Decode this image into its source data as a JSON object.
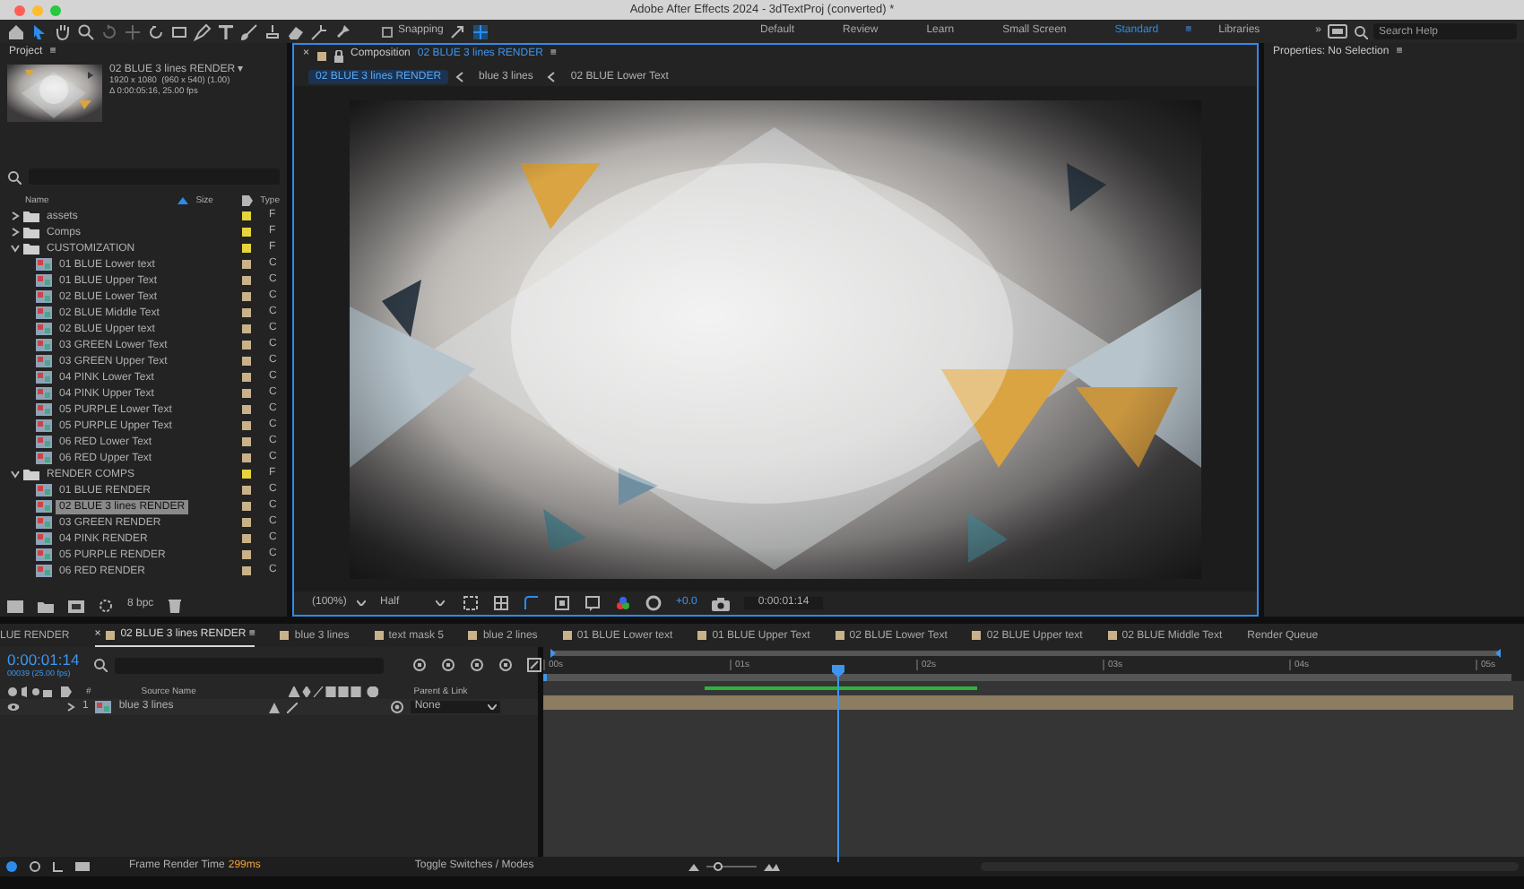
{
  "window": {
    "title": "Adobe After Effects 2024 - 3dTextProj (converted) *"
  },
  "toolbar": {
    "snapping": {
      "label": "Snapping",
      "checked": false
    },
    "workspaces": [
      {
        "label": "Default",
        "selected": false
      },
      {
        "label": "Review",
        "selected": false
      },
      {
        "label": "Learn",
        "selected": false
      },
      {
        "label": "Small Screen",
        "selected": false
      },
      {
        "label": "Standard",
        "selected": true,
        "menu": "≡"
      },
      {
        "label": "Libraries",
        "selected": false
      }
    ],
    "more": "»",
    "search": {
      "placeholder": "Search Help"
    }
  },
  "project": {
    "title": "Project",
    "menu": "≡",
    "selected_name": "02 BLUE 3 lines RENDER ▾",
    "info": [
      "1920 x 1080  (960 x 540) (1.00)",
      "Δ 0:00:05:16, 25.00 fps"
    ],
    "columns": [
      "Name",
      "Size",
      "Type"
    ],
    "items": [
      {
        "kind": "folder",
        "name": "assets",
        "type": "F",
        "color": "#e6d43c",
        "expanded": false,
        "selected": false
      },
      {
        "kind": "folder",
        "name": "Comps",
        "type": "F",
        "color": "#e6d43c",
        "expanded": false,
        "selected": false
      },
      {
        "kind": "folder",
        "name": "CUSTOMIZATION",
        "type": "F",
        "color": "#e6d43c",
        "expanded": true,
        "selected": false,
        "children": [
          {
            "kind": "comp",
            "name": "01 BLUE Lower text",
            "type": "C",
            "color": "#c9b28a",
            "selected": false
          },
          {
            "kind": "comp",
            "name": "01 BLUE Upper Text",
            "type": "C",
            "color": "#c9b28a",
            "selected": false
          },
          {
            "kind": "comp",
            "name": "02 BLUE Lower Text",
            "type": "C",
            "color": "#c9b28a",
            "selected": false
          },
          {
            "kind": "comp",
            "name": "02 BLUE Middle Text",
            "type": "C",
            "color": "#c9b28a",
            "selected": false
          },
          {
            "kind": "comp",
            "name": "02 BLUE Upper text",
            "type": "C",
            "color": "#c9b28a",
            "selected": false
          },
          {
            "kind": "comp",
            "name": "03 GREEN Lower Text",
            "type": "C",
            "color": "#c9b28a",
            "selected": false
          },
          {
            "kind": "comp",
            "name": "03 GREEN Upper Text",
            "type": "C",
            "color": "#c9b28a",
            "selected": false
          },
          {
            "kind": "comp",
            "name": "04 PINK Lower Text",
            "type": "C",
            "color": "#c9b28a",
            "selected": false
          },
          {
            "kind": "comp",
            "name": "04 PINK Upper Text",
            "type": "C",
            "color": "#c9b28a",
            "selected": false
          },
          {
            "kind": "comp",
            "name": "05 PURPLE Lower Text",
            "type": "C",
            "color": "#c9b28a",
            "selected": false
          },
          {
            "kind": "comp",
            "name": "05 PURPLE Upper Text",
            "type": "C",
            "color": "#c9b28a",
            "selected": false
          },
          {
            "kind": "comp",
            "name": "06 RED Lower Text",
            "type": "C",
            "color": "#c9b28a",
            "selected": false
          },
          {
            "kind": "comp",
            "name": "06 RED Upper Text",
            "type": "C",
            "color": "#c9b28a",
            "selected": false
          }
        ]
      },
      {
        "kind": "folder",
        "name": "RENDER COMPS",
        "type": "F",
        "color": "#e6d43c",
        "expanded": true,
        "selected": false,
        "children": [
          {
            "kind": "comp",
            "name": "01 BLUE RENDER",
            "type": "C",
            "color": "#c9b28a",
            "selected": false
          },
          {
            "kind": "comp",
            "name": "02 BLUE 3 lines RENDER",
            "type": "C",
            "color": "#c9b28a",
            "selected": true
          },
          {
            "kind": "comp",
            "name": "03 GREEN RENDER",
            "type": "C",
            "color": "#c9b28a",
            "selected": false
          },
          {
            "kind": "comp",
            "name": "04 PINK RENDER",
            "type": "C",
            "color": "#c9b28a",
            "selected": false
          },
          {
            "kind": "comp",
            "name": "05 PURPLE RENDER",
            "type": "C",
            "color": "#c9b28a",
            "selected": false
          },
          {
            "kind": "comp",
            "name": "06 RED RENDER",
            "type": "C",
            "color": "#c9b28a",
            "selected": false
          }
        ]
      }
    ],
    "bpc": "8 bpc"
  },
  "composition": {
    "close": "×",
    "title": "Composition",
    "name": "02 BLUE 3 lines RENDER",
    "menu": "≡",
    "breadcrumbs": [
      {
        "label": "02 BLUE 3 lines RENDER",
        "selected": true
      },
      {
        "label": "blue 3 lines",
        "selected": false
      },
      {
        "label": "02 BLUE Lower Text",
        "selected": false
      }
    ],
    "zoom": "(100%)",
    "resolution": "Half",
    "exposure": "+0.0",
    "time": "0:00:01:14"
  },
  "properties": {
    "title": "Properties: No Selection",
    "menu": "≡"
  },
  "timeline": {
    "tabs": [
      {
        "label": "LUE RENDER",
        "swatch": false,
        "selected": false
      },
      {
        "label": "02 BLUE 3 lines RENDER",
        "swatch": true,
        "selected": true,
        "close": "×",
        "menu": "≡"
      },
      {
        "label": "blue 3 lines",
        "swatch": true,
        "selected": false
      },
      {
        "label": "text mask 5",
        "swatch": true,
        "selected": false
      },
      {
        "label": "blue 2 lines",
        "swatch": true,
        "selected": false
      },
      {
        "label": "01 BLUE Lower text",
        "swatch": true,
        "selected": false
      },
      {
        "label": "01 BLUE Upper Text",
        "swatch": true,
        "selected": false
      },
      {
        "label": "02 BLUE Lower Text",
        "swatch": true,
        "selected": false
      },
      {
        "label": "02 BLUE Upper text",
        "swatch": true,
        "selected": false
      },
      {
        "label": "02 BLUE Middle Text",
        "swatch": true,
        "selected": false
      },
      {
        "label": "Render Queue",
        "swatch": false,
        "selected": false
      }
    ],
    "time": "0:00:01:14",
    "frame": "00039 (25.00 fps)",
    "columns": {
      "number": "#",
      "source": "Source Name",
      "parent": "Parent & Link"
    },
    "ruler": [
      "00s",
      "01s",
      "02s",
      "03s",
      "04s",
      "05s"
    ],
    "playhead": {
      "level": 0.3
    },
    "layers": [
      {
        "number": "1",
        "name": "blue 3 lines",
        "parent": "None"
      }
    ]
  },
  "status": {
    "render_label": "Frame Render Time",
    "render_time": "299ms",
    "toggle": "Toggle Switches / Modes",
    "zoom_slider": {
      "level": 0.25
    }
  }
}
